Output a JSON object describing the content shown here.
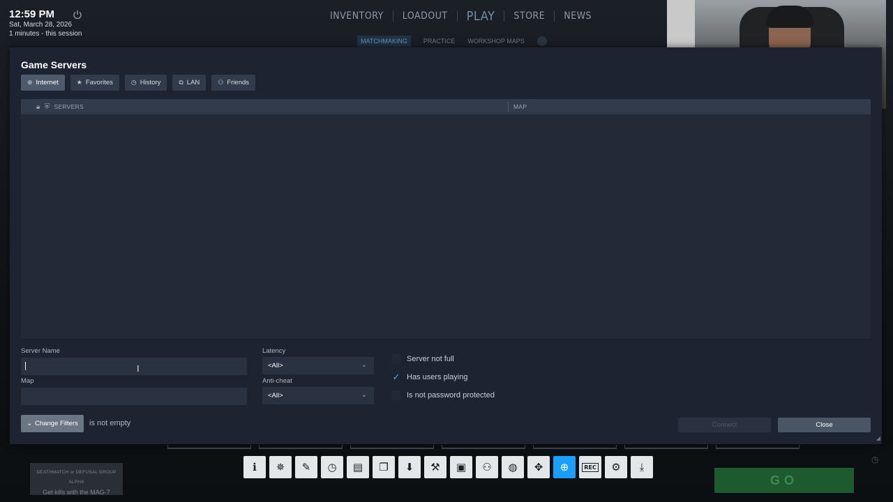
{
  "system": {
    "time": "12:59 PM",
    "date": "Sat, March 28, 2026",
    "session": "1 minutes - this session"
  },
  "game_nav": {
    "items": [
      "INVENTORY",
      "LOADOUT",
      "PLAY",
      "STORE",
      "NEWS"
    ],
    "subnav": [
      "MATCHMAKING",
      "PRACTICE",
      "WORKSHOP MAPS"
    ]
  },
  "dialog": {
    "title": "Game Servers",
    "tabs": [
      {
        "label": "Internet",
        "icon": "globe-icon",
        "active": true
      },
      {
        "label": "Favorites",
        "icon": "star-icon",
        "active": false
      },
      {
        "label": "History",
        "icon": "clock-icon",
        "active": false
      },
      {
        "label": "LAN",
        "icon": "network-icon",
        "active": false
      },
      {
        "label": "Friends",
        "icon": "people-icon",
        "active": false
      }
    ],
    "columns": {
      "servers": "SERVERS",
      "map": "MAP"
    },
    "filters": {
      "server_name_label": "Server Name",
      "server_name_value": "",
      "map_label": "Map",
      "map_value": "",
      "latency_label": "Latency",
      "latency_value": "<All>",
      "anticheat_label": "Anti-cheat",
      "anticheat_value": "<All>",
      "checks": [
        {
          "label": "Server not full",
          "checked": false
        },
        {
          "label": "Has users playing",
          "checked": true
        },
        {
          "label": "Is not password protected",
          "checked": false
        }
      ]
    },
    "change_filters_label": "Change Filters",
    "filter_summary": "is not empty",
    "connect_label": "Connect",
    "close_label": "Close"
  },
  "mission": {
    "line1": "DEATHMATCH or DEFUSAL GROUP ALPHA",
    "line2": "Get kills with the MAG-7"
  },
  "go_label": "GO",
  "toolbar_icons": [
    "info-icon",
    "badge-icon",
    "pencil-icon",
    "clock-icon",
    "notebook-icon",
    "chat-icon",
    "download-icon",
    "wrench-icon",
    "screenshot-icon",
    "friends-icon",
    "compass-icon",
    "gamepad-icon",
    "globe-icon",
    "rec-icon",
    "gear-icon",
    "minimize-icon"
  ],
  "colors": {
    "accent": "#1a9fff",
    "dialog_bg": "#1d2331",
    "go_green": "#1d5a2e"
  }
}
